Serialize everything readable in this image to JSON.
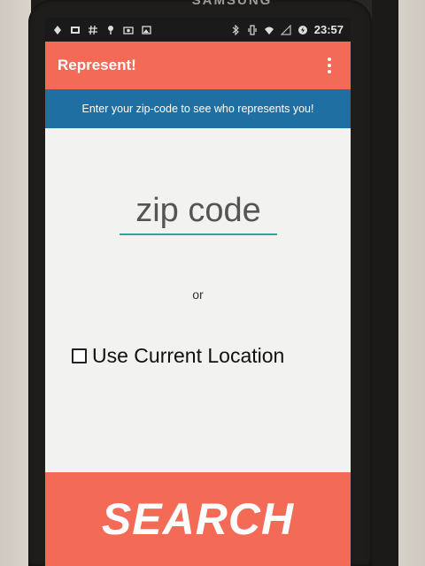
{
  "device": {
    "brand": "SAMSUNG"
  },
  "statusbar": {
    "left_icons": [
      "navigation-icon",
      "image-icon",
      "hashtag-icon",
      "pin-icon",
      "photo-icon",
      "gallery-icon"
    ],
    "right_icons": [
      "bluetooth-icon",
      "vibrate-icon",
      "wifi-icon",
      "signal-icon",
      "battery-icon"
    ],
    "time": "23:57"
  },
  "appbar": {
    "title": "Represent!"
  },
  "banner": {
    "text": "Enter your zip-code to see who represents you!"
  },
  "form": {
    "zip_placeholder": "zip code",
    "zip_value": "",
    "or_text": "or",
    "use_location_label": "Use Current Location",
    "use_location_checked": false
  },
  "search": {
    "label": "SEARCH"
  },
  "colors": {
    "accent": "#f36a57",
    "banner": "#1f6fa3",
    "underline": "#2aa69a"
  }
}
